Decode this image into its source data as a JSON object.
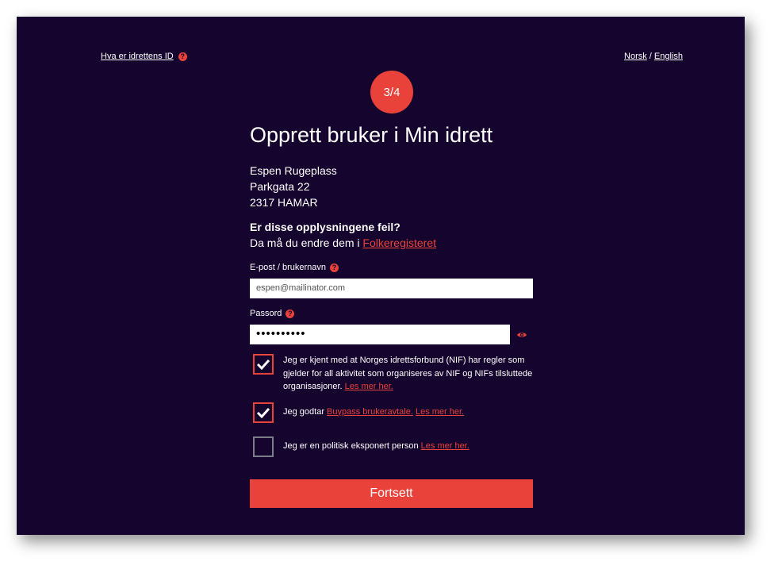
{
  "topnav": {
    "whats_id_link": "Hva er idrettens ID",
    "lang_norsk": "Norsk",
    "lang_separator": " / ",
    "lang_english": "English"
  },
  "step": {
    "label": "3/4"
  },
  "heading": "Opprett bruker i Min idrett",
  "address": {
    "name": "Espen Rugeplass",
    "street": "Parkgata 22",
    "city": "2317 HAMAR"
  },
  "wrong_info": {
    "question": "Er disse opplysningene feil?",
    "change_prefix": "Da må du endre dem i ",
    "change_link": "Folkeregisteret"
  },
  "form": {
    "email_label": "E-post / brukernavn",
    "email_value": "espen@mailinator.com",
    "password_label": "Passord",
    "password_value": "••••••••••"
  },
  "checkboxes": [
    {
      "checked": true,
      "text": "Jeg er kjent med at Norges idrettsforbund (NIF) har regler som gjelder for all aktivitet som organiseres av NIF og NIFs tilsluttede organisasjoner. ",
      "link": "Les mer her."
    },
    {
      "checked": true,
      "text": "Jeg godtar ",
      "link1": "Buypass brukeravtale.",
      "link2": "Les mer her."
    },
    {
      "checked": false,
      "text": "Jeg er en politisk eksponert person ",
      "link": "Les mer her."
    }
  ],
  "submit_label": "Fortsett",
  "colors": {
    "background": "#15042e",
    "accent": "#e9423a",
    "unchecked_border": "#7d7d8a"
  },
  "icons": {
    "help": "question-circle-icon",
    "show_password": "eye-icon",
    "checkmark": "checkmark-icon"
  }
}
